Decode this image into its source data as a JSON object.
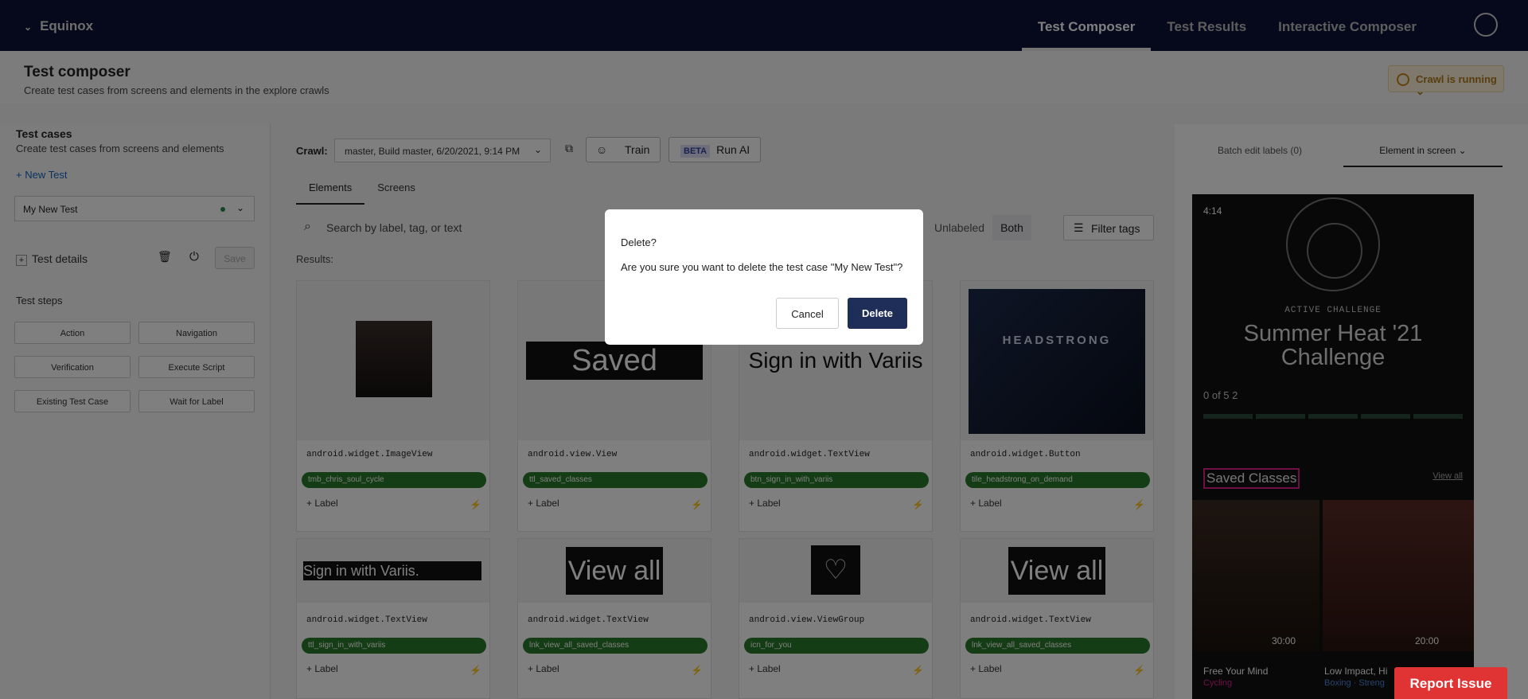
{
  "topbar": {
    "brand": "Equinox",
    "nav": [
      {
        "label": "Test Composer"
      },
      {
        "label": "Test Results"
      },
      {
        "label": "Interactive Composer"
      }
    ]
  },
  "page": {
    "title": "Test composer",
    "subtitle": "Create test cases from screens and elements in the explore crawls",
    "crawl_status": "Crawl is running"
  },
  "left": {
    "title": "Test cases",
    "subtitle": "Create test cases from screens and elements",
    "new_test": "New Test",
    "selected_test": "My New Test",
    "test_details": "Test details",
    "save": "Save",
    "test_steps": "Test steps",
    "steps": [
      "Action",
      "Navigation",
      "Verification",
      "Execute Script",
      "Existing Test Case",
      "Wait for Label"
    ]
  },
  "center": {
    "crawl_label": "Crawl:",
    "crawl_value": "master, Build master, 6/20/2021, 9:14 PM",
    "train": "Train",
    "beta": "BETA",
    "run_ai": "Run AI",
    "tabs": [
      "Elements",
      "Screens"
    ],
    "search_placeholder": "Search by label, tag, or text",
    "toggle": [
      "Unlabeled",
      "Both"
    ],
    "filter_tags": "Filter tags",
    "results_label": "Results:",
    "add_label": "+ Label",
    "cards": [
      {
        "cls": "android.widget.ImageView",
        "tag": "tmb_chris_soul_cycle",
        "preview": ""
      },
      {
        "cls": "android.view.View",
        "tag": "ttl_saved_classes",
        "preview": "Saved Classes"
      },
      {
        "cls": "android.widget.TextView",
        "tag": "btn_sign_in_with_variis",
        "preview": "Sign in with Variis"
      },
      {
        "cls": "android.widget.Button",
        "tag": "tile_headstrong_on_demand",
        "preview": "HEADSTRONG"
      },
      {
        "cls": "android.widget.TextView",
        "tag": "ttl_sign_in_with_variis",
        "preview": "Sign in with Variis."
      },
      {
        "cls": "android.widget.TextView",
        "tag": "lnk_view_all_saved_classes",
        "preview": "View all"
      },
      {
        "cls": "android.view.ViewGroup",
        "tag": "icn_for_you",
        "preview": ""
      },
      {
        "cls": "android.widget.TextView",
        "tag": "lnk_view_all_saved_classes",
        "preview": "View all"
      }
    ]
  },
  "right": {
    "tab_batch": "Batch edit labels (0)",
    "tab_element": "Element in screen",
    "phone": {
      "time": "4:14",
      "active_challenge": "ACTIVE CHALLENGE",
      "challenge": "Summer Heat '21 Challenge",
      "progress": "0 of 5  2",
      "saved_classes": "Saved Classes",
      "view_all": "View all",
      "dur1": "30:00",
      "dur2": "20:00",
      "title1": "Free Your Mind",
      "title2": "Low Impact, Hi",
      "sub1": "Cycling",
      "sub2": "Boxing · Streng"
    }
  },
  "modal": {
    "title": "Delete?",
    "body": "Are you sure you want to delete the test case \"My New Test\"?",
    "cancel": "Cancel",
    "delete": "Delete"
  },
  "report_issue": "Report Issue"
}
